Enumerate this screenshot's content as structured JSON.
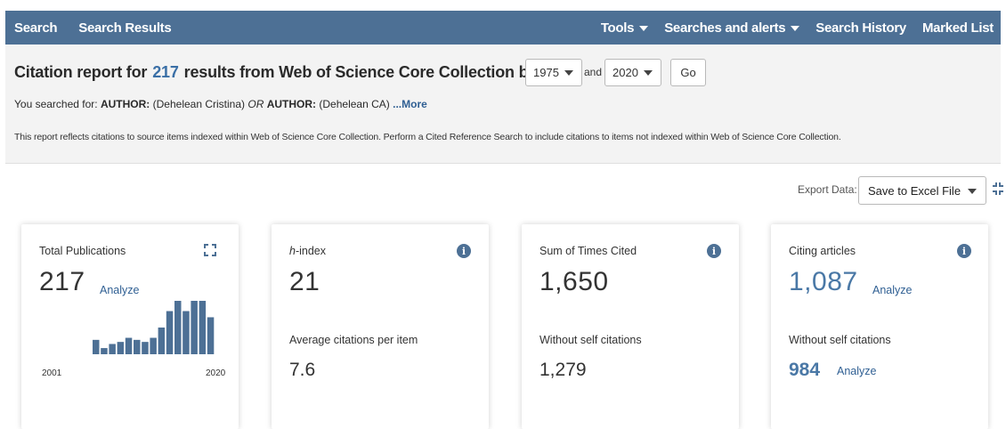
{
  "nav": {
    "search": "Search",
    "search_results": "Search Results",
    "tools": "Tools",
    "searches_alerts": "Searches and alerts",
    "search_history": "Search History",
    "marked_list": "Marked List"
  },
  "report": {
    "title_prefix": "Citation report for",
    "count": "217",
    "title_suffix": "results from Web of Science Core Collection between",
    "year_from": "1975",
    "and_label": "and",
    "year_to": "2020",
    "go_label": "Go",
    "searched_for_label": "You searched for:",
    "author_label_1": "AUTHOR:",
    "author_query_1": "(Dehelean Cristina)",
    "operator": "OR",
    "author_label_2": "AUTHOR:",
    "author_query_2": "(Dehelean CA)",
    "more_link": "...More",
    "note": "This report reflects citations to source items indexed within Web of Science Core Collection. Perform a Cited Reference Search to include citations to items not indexed within Web of Science Core Collection."
  },
  "export": {
    "label": "Export Data:",
    "value": "Save to Excel File"
  },
  "cards": {
    "total_publications": {
      "title": "Total Publications",
      "value": "217",
      "analyze": "Analyze",
      "start_year": "2001",
      "end_year": "2020"
    },
    "h_index": {
      "title_italic": "h",
      "title_rest": "-index",
      "value": "21",
      "sub_label": "Average citations per item",
      "sub_value": "7.6"
    },
    "sum_times_cited": {
      "title": "Sum of Times Cited",
      "value": "1,650",
      "sub_label": "Without self citations",
      "sub_value": "1,279"
    },
    "citing_articles": {
      "title": "Citing articles",
      "value": "1,087",
      "analyze": "Analyze",
      "sub_label": "Without self citations",
      "sub_value": "984",
      "sub_analyze": "Analyze"
    }
  },
  "sparkline": {
    "color": "#4d7095",
    "values": [
      7,
      3,
      5,
      6,
      8,
      7,
      6,
      8,
      13,
      21,
      26,
      21,
      26,
      26,
      18
    ]
  },
  "colors": {
    "nav_bg": "#4d7095",
    "link": "#2f5f93",
    "accent_number": "#4a78a6"
  }
}
